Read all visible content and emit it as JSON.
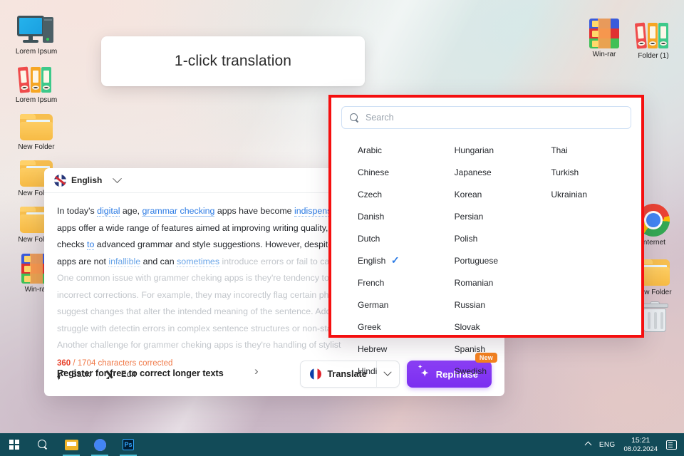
{
  "tooltip": {
    "text": "1-click translation"
  },
  "desktop": {
    "icons_left": [
      {
        "label": "Lorem Ipsum",
        "icon": "computer-icon"
      },
      {
        "label": "Lorem Ipsum",
        "icon": "binders-icon"
      },
      {
        "label": "New Folder",
        "icon": "folder-icon"
      },
      {
        "label": "New Folder",
        "icon": "folder-icon"
      },
      {
        "label": "New Folder",
        "icon": "folder-icon"
      },
      {
        "label": "Win-rar",
        "icon": "winrar-icon"
      }
    ],
    "icons_right": [
      {
        "label": "Win-rar",
        "icon": "winrar-icon"
      },
      {
        "label": "Folder (1)",
        "icon": "binders-icon"
      },
      {
        "label": "Internet",
        "icon": "chrome-icon"
      },
      {
        "label": "New Folder",
        "icon": "folder-icon"
      },
      {
        "label": "",
        "icon": "recycle-bin-icon"
      }
    ]
  },
  "app": {
    "source_language": "English",
    "paragraph": {
      "l1_a": "In today's ",
      "l1_digital": "digital",
      "l1_b": " age, ",
      "l1_grammar": "grammar",
      "l1_c": " ",
      "l1_checking": "checking",
      "l1_d": " apps have become ",
      "l1_indispensable": "indispensable",
      "l2": "apps offer a wide range of features aimed at improving writing quality, fro",
      "l3_a": "checks ",
      "l3_to": "to",
      "l3_b": " advanced grammar and style suggestions. However, despite th",
      "l4_a": "apps are not ",
      "l4_infallible": "infallible",
      "l4_b": " and can ",
      "l4_sometimes": "sometimes",
      "l4_c": " introduce errors or fail to catch",
      "l5": "One common issue with grammer cheking apps is they're tendency to mi",
      "l6": "incorrect corrections. For example, they may incorectly flag certain phras",
      "l7": "suggest changes that alter the intended meaning of the sentence. Additio",
      "l8": "struggle with detectin errors in complex sentence structures or non-stand",
      "l9": "Another challenge for grammer cheking apps is they're handling of stylist"
    },
    "counter": {
      "corrected": "360",
      "rest": " / 1704 characters corrected",
      "register": "Register for free to correct longer texts",
      "arrow": "›"
    },
    "footer": {
      "back_label": "Back",
      "edit_label": "Edit",
      "translate_label": "Translate",
      "translate_flag": "france-flag-icon",
      "rephrase_label": "Rephrase",
      "rephrase_badge": "New"
    }
  },
  "lang_panel": {
    "search_placeholder": "Search",
    "search_value": "",
    "selected": "English",
    "check_glyph": "✓",
    "languages": [
      "Arabic",
      "Chinese",
      "Czech",
      "Danish",
      "Dutch",
      "English",
      "French",
      "German",
      "Greek",
      "Hebrew",
      "Hindi",
      "Hungarian",
      "Japanese",
      "Korean",
      "Persian",
      "Polish",
      "Portuguese",
      "Romanian",
      "Russian",
      "Slovak",
      "Spanish",
      "Swedish",
      "Thai",
      "Turkish",
      "Ukrainian"
    ],
    "highlight_color": "#f50f0f"
  },
  "taskbar": {
    "items": [
      {
        "name": "start-button",
        "icon": "windows-logo-icon"
      },
      {
        "name": "taskbar-search",
        "icon": "search-icon"
      },
      {
        "name": "file-explorer",
        "icon": "folder-icon"
      },
      {
        "name": "chrome",
        "icon": "chrome-icon"
      },
      {
        "name": "photoshop",
        "icon": "photoshop-icon",
        "label": "Ps"
      }
    ],
    "tray": {
      "language": "ENG",
      "time": "15:21",
      "date": "08.02.2024"
    }
  }
}
